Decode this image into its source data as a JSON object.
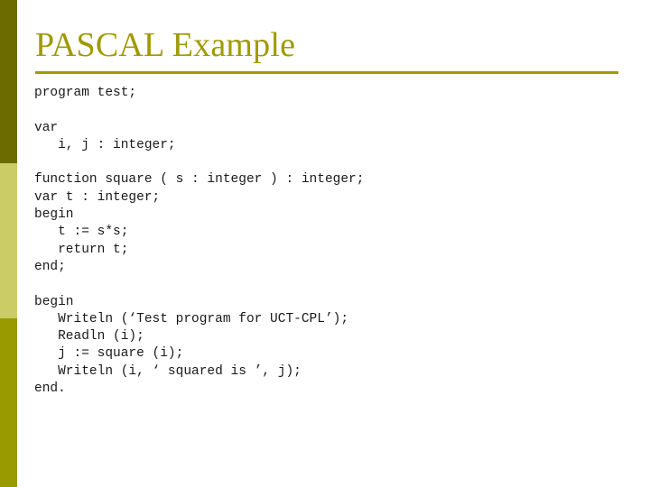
{
  "slide": {
    "title": "PASCAL Example",
    "accent_color": "#a09a00",
    "background_color": "#ffffff",
    "text_color": "#1a1a1a"
  },
  "sidebar": {
    "bands": [
      {
        "name": "band-top",
        "color": "#6b6b00"
      },
      {
        "name": "band-middle",
        "color": "#cccc66"
      },
      {
        "name": "band-bottom",
        "color": "#999900"
      }
    ]
  },
  "code": {
    "language": "pascal",
    "lines": [
      "program test;",
      "",
      "var",
      "   i, j : integer;",
      "",
      "function square ( s : integer ) : integer;",
      "var t : integer;",
      "begin",
      "   t := s*s;",
      "   return t;",
      "end;",
      "",
      "begin",
      "   Writeln (‘Test program for UCT-CPL’);",
      "   Readln (i);",
      "   j := square (i);",
      "   Writeln (i, ‘ squared is ’, j);",
      "end."
    ]
  }
}
